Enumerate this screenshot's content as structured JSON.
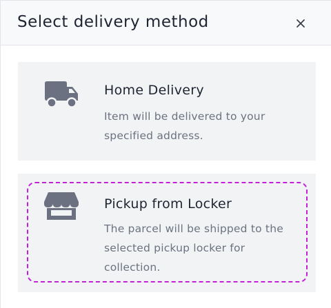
{
  "modal": {
    "title": "Select delivery method",
    "close_icon": "close-icon",
    "close_glyph": "✕"
  },
  "options": [
    {
      "icon": "truck-icon",
      "title": "Home Delivery",
      "description": "Item will be delivered to your specified address.",
      "focused": false
    },
    {
      "icon": "store-icon",
      "title": "Pickup from Locker",
      "description": "The parcel will be shipped to the selected pickup locker for collection.",
      "focused": true
    }
  ],
  "colors": {
    "icon": "#6b7180",
    "card_background": "#f2f3f5",
    "focus_ring": "#c21fd6",
    "header_background": "#f8f9fa"
  }
}
